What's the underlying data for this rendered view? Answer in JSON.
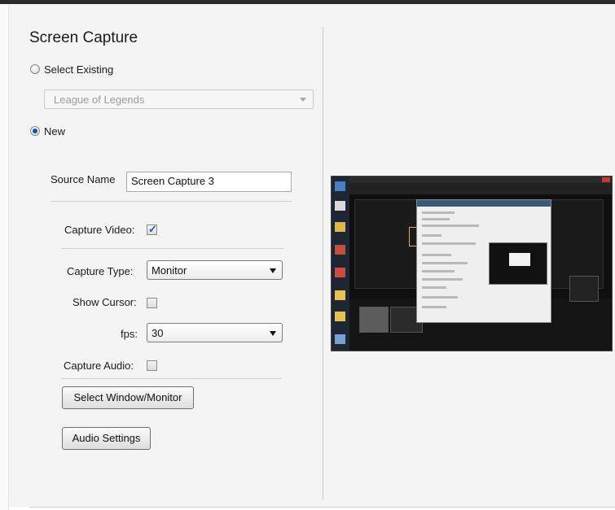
{
  "panel": {
    "title": "Screen Capture",
    "select_existing_label": "Select Existing",
    "existing_source_value": "League of Legends",
    "new_label": "New",
    "source_name_label": "Source Name",
    "source_name_value": "Screen Capture 3",
    "capture_video_label": "Capture Video:",
    "capture_video_checked": true,
    "capture_type_label": "Capture Type:",
    "capture_type_value": "Monitor",
    "show_cursor_label": "Show Cursor:",
    "show_cursor_checked": false,
    "fps_label": "fps:",
    "fps_value": "30",
    "capture_audio_label": "Capture Audio:",
    "capture_audio_checked": false,
    "select_window_button": "Select Window/Monitor",
    "audio_settings_button": "Audio Settings",
    "checkmark_glyph": "✓"
  },
  "colors": {
    "panel_bg": "#f4f4f4",
    "radio_selected": "#1a4fa8",
    "checkmark": "#2c5aa0"
  }
}
